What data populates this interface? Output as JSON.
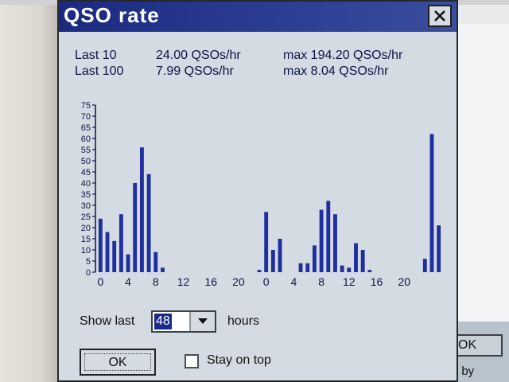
{
  "dialog": {
    "title": "QSO rate"
  },
  "stats": [
    {
      "label": "Last 10",
      "rate": "24.00 QSOs/hr",
      "max": "max 194.20 QSOs/hr"
    },
    {
      "label": "Last 100",
      "rate": "7.99 QSOs/hr",
      "max": "max 8.04 QSOs/hr"
    }
  ],
  "controls": {
    "show_last_label": "Show last",
    "show_last_value": "48",
    "hours_label": "hours",
    "ok_label": "OK",
    "stay_on_top_label": "Stay on top",
    "stay_on_top_checked": false
  },
  "background_window": {
    "ok_label": "OK",
    "partial_text": "t by"
  },
  "colors": {
    "bar": "#1f2f9e",
    "axis": "#0c1446",
    "titlebar": "#1b2a80"
  },
  "chart_data": {
    "type": "bar",
    "ylim": [
      0,
      75
    ],
    "y_ticks": [
      0,
      5,
      10,
      15,
      20,
      25,
      30,
      35,
      40,
      45,
      50,
      55,
      60,
      65,
      70,
      75
    ],
    "x_tick_labels": [
      "0",
      "4",
      "8",
      "12",
      "16",
      "20",
      "0",
      "4",
      "8",
      "12",
      "16",
      "20"
    ],
    "values": [
      24,
      18,
      14,
      26,
      8,
      40,
      56,
      44,
      9,
      2,
      0,
      0,
      0,
      0,
      0,
      0,
      0,
      0,
      0,
      0,
      0,
      0,
      0,
      1,
      27,
      10,
      15,
      0,
      0,
      4,
      4,
      12,
      28,
      32,
      26,
      3,
      2,
      13,
      10,
      1,
      0,
      0,
      0,
      0,
      0,
      0,
      0,
      6,
      62,
      21
    ]
  }
}
